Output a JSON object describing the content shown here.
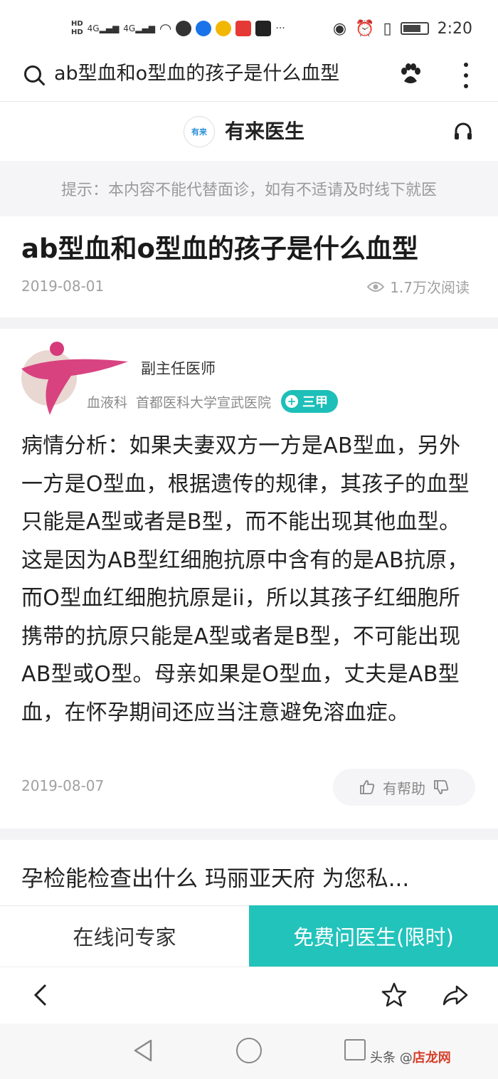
{
  "status_bar": {
    "network_left": "HD",
    "signal_label": "4G",
    "more": "···",
    "time": "2:20",
    "battery_level": 0.8
  },
  "search_bar": {
    "query": "ab型血和o型血的孩子是什么血型"
  },
  "site": {
    "logo_text": "有来",
    "name": "有来医生"
  },
  "notice": "提示：本内容不能代替面诊，如有不适请及时线下就医",
  "article": {
    "title": "ab型血和o型血的孩子是什么血型",
    "date": "2019-08-01",
    "views": "1.7万次阅读"
  },
  "doctor": {
    "title": "副主任医师",
    "department": "血液科",
    "hospital": "首都医科大学宣武医院",
    "grade": "三甲"
  },
  "answer": {
    "text": "病情分析：如果夫妻双方一方是AB型血，另外一方是O型血，根据遗传的规律，其孩子的血型只能是A型或者是B型，而不能出现其他血型。这是因为AB型红细胞抗原中含有的是AB抗原，而O型血红细胞抗原是ii，所以其孩子红细胞所携带的抗原只能是A型或者是B型，不可能出现AB型或O型。母亲如果是O型血，丈夫是AB型血，在怀孕期间还应当注意避免溶血症。",
    "date": "2019-08-07",
    "helpful_label": "有帮助"
  },
  "next_article": {
    "title": "孕检能检查出什么 玛丽亚天府 为您私..."
  },
  "actions": {
    "expert": "在线问专家",
    "free_ask": "免费问医生(限时)"
  },
  "watermark": {
    "prefix": "头条 @",
    "brand": "店龙网"
  },
  "colors": {
    "accent": "#22c3bb",
    "badge": "#1dbfb8"
  }
}
